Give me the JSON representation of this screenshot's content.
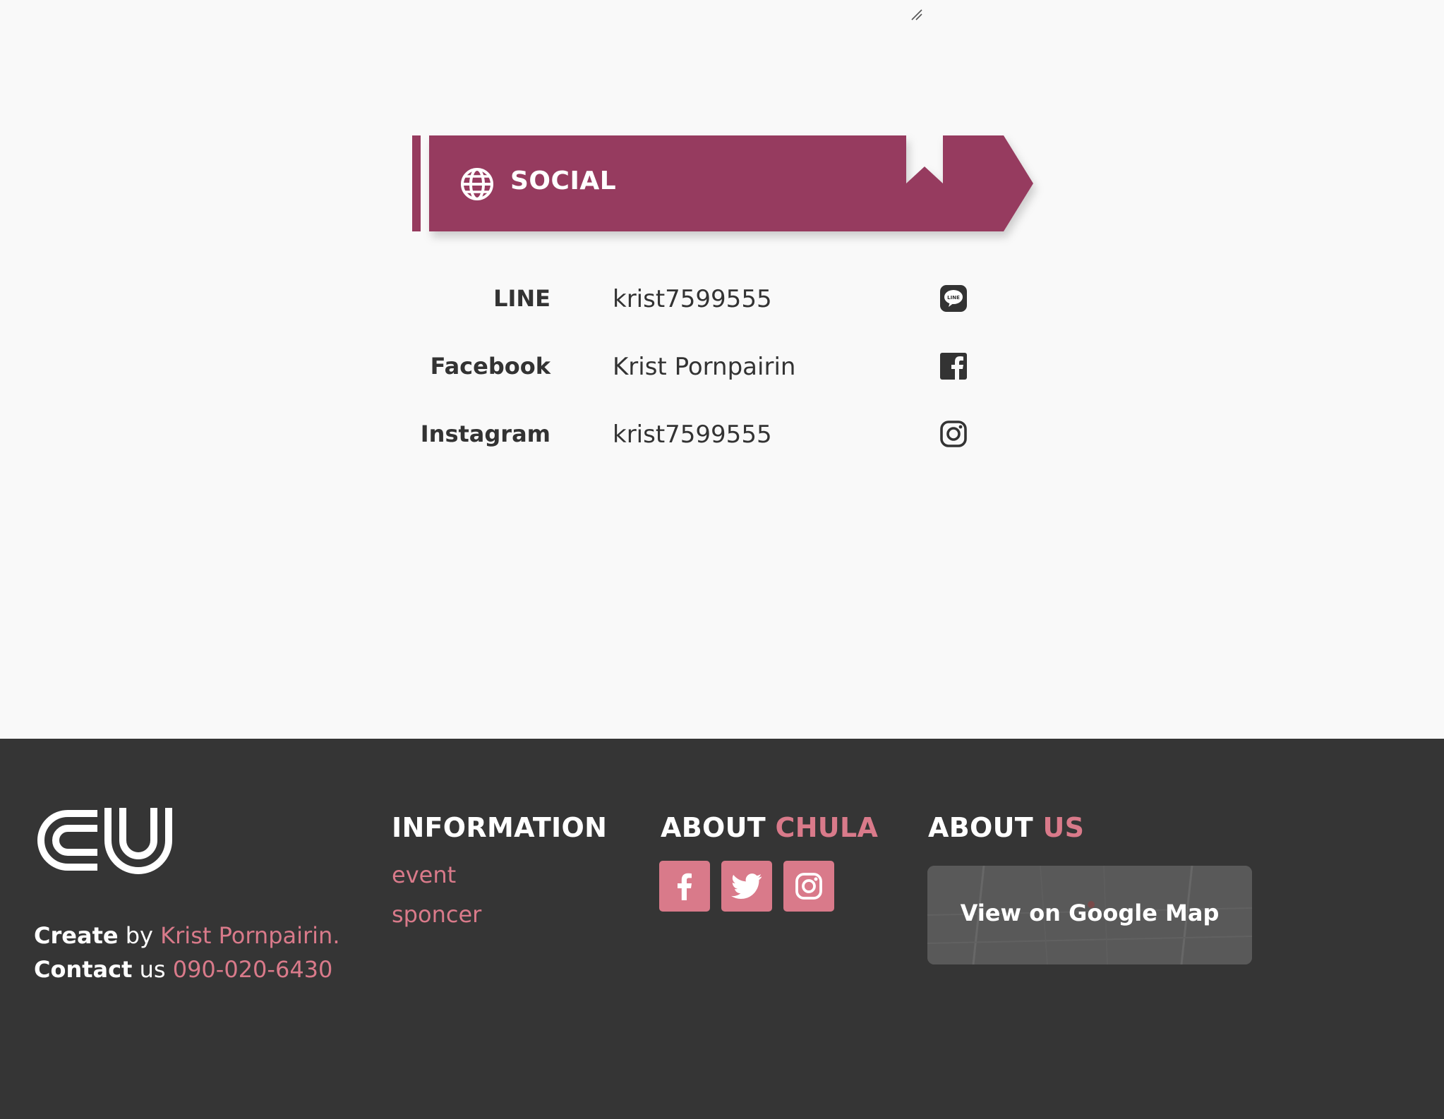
{
  "banner": {
    "title": "SOCIAL"
  },
  "social": [
    {
      "label": "LINE",
      "value": "krist7599555",
      "icon": "line-icon"
    },
    {
      "label": "Facebook",
      "value": "Krist Pornpairin",
      "icon": "facebook-icon"
    },
    {
      "label": "Instagram",
      "value": "krist7599555",
      "icon": "instagram-icon"
    }
  ],
  "footer": {
    "logo_text": "CU",
    "create_bold": "Create",
    "create_by": "by",
    "author": "Krist Pornpairin.",
    "contact_bold": "Contact",
    "contact_us": "us",
    "phone": "090-020-6430",
    "information": {
      "heading": "INFORMATION",
      "links": [
        "event",
        "sponcer"
      ]
    },
    "about_chula": {
      "heading_main": "ABOUT",
      "heading_accent": "CHULA",
      "buttons": [
        "facebook-icon",
        "twitter-icon",
        "instagram-icon"
      ]
    },
    "about_us": {
      "heading_main": "ABOUT",
      "heading_accent": "US",
      "map_button": "View on Google Map"
    }
  },
  "colors": {
    "banner": "#963b5e",
    "accent": "#d97a8a",
    "footer_bg": "#353535",
    "page_bg": "#f9f9f9",
    "text_dark": "#333333"
  }
}
